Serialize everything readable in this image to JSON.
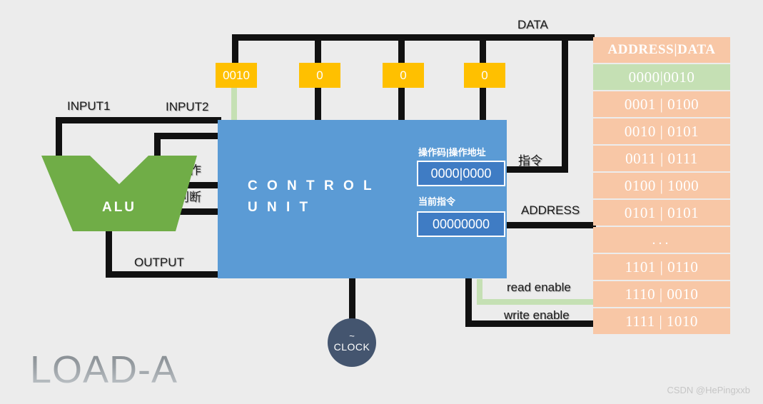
{
  "title": "LOAD-A",
  "watermark": "CSDN @HePingxxb",
  "bus_labels": {
    "data": "DATA",
    "address": "ADDRESS",
    "instruction": "指令",
    "read_enable": "read enable",
    "write_enable": "write enable"
  },
  "alu": {
    "name": "ALU",
    "input1": "INPUT1",
    "input2": "INPUT2",
    "operation": "操作",
    "condition": "判断",
    "output": "OUTPUT"
  },
  "control_unit": {
    "title_line1": "C O N T R O L",
    "title_line2": "U N I T",
    "fields": [
      {
        "label": "操作码|操作地址",
        "value": "0000|0000"
      },
      {
        "label": "当前指令",
        "value": "00000000"
      }
    ]
  },
  "registers": [
    {
      "name": "register-a",
      "value": "0010",
      "active": true
    },
    {
      "name": "register-b",
      "value": "0",
      "active": false
    },
    {
      "name": "register-c",
      "value": "0",
      "active": false
    },
    {
      "name": "register-d",
      "value": "0",
      "active": false
    }
  ],
  "clock": {
    "symbol": "~",
    "label": "CLOCK"
  },
  "memory": {
    "header": "ADDRESS|DATA",
    "rows": [
      {
        "text": "0000|0010",
        "highlighted": true
      },
      {
        "text": "0001 | 0100",
        "highlighted": false
      },
      {
        "text": "0010 | 0101",
        "highlighted": false
      },
      {
        "text": "0011 | 0111",
        "highlighted": false
      },
      {
        "text": "0100 | 1000",
        "highlighted": false
      },
      {
        "text": "0101 | 0101",
        "highlighted": false
      },
      {
        "text": "...",
        "highlighted": false
      },
      {
        "text": "1101 | 0110",
        "highlighted": false
      },
      {
        "text": "1110 | 0010",
        "highlighted": false
      },
      {
        "text": "1111 | 1010",
        "highlighted": false
      }
    ]
  },
  "colors": {
    "background": "#ececec",
    "alu": "#70ad47",
    "control_unit": "#5b9bd5",
    "register": "#ffc000",
    "memory_row": "#f8c7a6",
    "memory_highlight": "#c5e0b4",
    "clock": "#44556f",
    "wire": "#111111",
    "active_wire": "#c5e0b4"
  }
}
